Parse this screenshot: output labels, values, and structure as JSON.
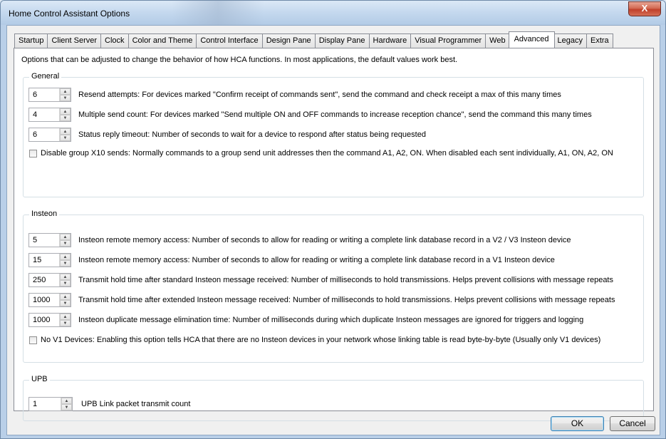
{
  "window": {
    "title": "Home Control Assistant Options",
    "close_glyph": "X"
  },
  "tabs": [
    "Startup",
    "Client Server",
    "Clock",
    "Color and Theme",
    "Control Interface",
    "Design Pane",
    "Display Pane",
    "Hardware",
    "Visual Programmer",
    "Web",
    "Advanced",
    "Legacy",
    "Extra"
  ],
  "active_tab": "Advanced",
  "intro": "Options that can be adjusted to change the behavior of how HCA functions.  In most applications, the default values work best.",
  "general": {
    "label": "General",
    "rows": [
      {
        "value": "6",
        "text": "Resend attempts: For devices marked \"Confirm receipt of commands sent\", send the command and check receipt a max of this many times"
      },
      {
        "value": "4",
        "text": "Multiple send count: For devices marked \"Send multiple ON and OFF commands to increase reception chance\", send the command this many times"
      },
      {
        "value": "6",
        "text": "Status reply timeout: Number of seconds to wait for a device to respond after status being requested"
      }
    ],
    "checkbox": "Disable group X10 sends: Normally commands to a group send unit addresses then the command A1, A2, ON. When disabled each sent individually, A1, ON, A2, ON"
  },
  "insteon": {
    "label": "Insteon",
    "rows": [
      {
        "value": "5",
        "text": "Insteon remote memory access: Number of seconds to allow for reading or writing a complete link database record in a V2 / V3 Insteon device"
      },
      {
        "value": "15",
        "text": "Insteon remote memory access: Number of seconds to allow for reading or writing a complete link database record in a V1 Insteon device"
      },
      {
        "value": "250",
        "text": "Transmit hold time after standard Insteon message received: Number of milliseconds to hold transmissions. Helps prevent collisions with message repeats"
      },
      {
        "value": "1000",
        "text": "Transmit hold time after extended Insteon message received: Number of milliseconds to hold transmissions. Helps prevent collisions with message repeats"
      },
      {
        "value": "1000",
        "text": "Insteon duplicate message elimination time: Number of milliseconds during which duplicate Insteon messages are ignored for triggers and logging"
      }
    ],
    "checkbox": "No V1 Devices: Enabling this option tells HCA that there are no Insteon devices in your network whose linking table is read byte-by-byte (Usually only V1 devices)"
  },
  "upb": {
    "label": "UPB",
    "rows": [
      {
        "value": "1",
        "text": "UPB Link packet transmit count"
      }
    ]
  },
  "buttons": {
    "ok": "OK",
    "cancel": "Cancel"
  },
  "icons": {
    "spin_up": "spin-up-arrow-icon",
    "spin_down": "spin-down-arrow-icon",
    "close": "close-icon"
  }
}
